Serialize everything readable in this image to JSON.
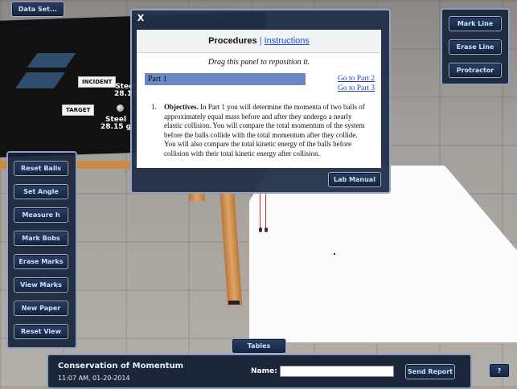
{
  "toolbar": {
    "data_set_label": "Data Set..."
  },
  "scene_labels": {
    "incident": "INCIDENT",
    "target": "TARGET",
    "incident_material": "Steel",
    "incident_mass": "28.15",
    "target_material": "Steel",
    "target_mass": "28.15 g"
  },
  "dialog": {
    "close": "X",
    "header_active": "Procedures",
    "header_separator": "|",
    "header_link": "Instructions",
    "drag_note": "Drag this panel to reposition it.",
    "part_title": "Part 1",
    "goto_part2": "Go to Part 2",
    "goto_part3": "Go to Part 3",
    "objective_number": "1.",
    "objective_heading": "Objectives.",
    "objective_text": "In Part 1 you will determine the momenta of two balls of approximately equal mass before and after they undergo a nearly elastic collision. You will compare the total momentum of the system before the balls collide with the total momentum after they collide. You will also compare the total kinetic energy of the balls before collision with their total kinetic energy after collision.",
    "lab_manual": "Lab Manual"
  },
  "right_tools": [
    "Mark Line",
    "Erase Line",
    "Protractor"
  ],
  "left_tools": [
    "Reset Balls",
    "Set Angle",
    "Measure h",
    "Mark Bobs",
    "Erase Marks",
    "View Marks",
    "New Paper",
    "Reset View"
  ],
  "tables_label": "Tables",
  "bottom": {
    "title": "Conservation of Momentum",
    "timestamp": "11:07 AM, 01-20-2014",
    "name_label": "Name:",
    "name_value": "",
    "send_report": "Send Report",
    "help": "?"
  }
}
